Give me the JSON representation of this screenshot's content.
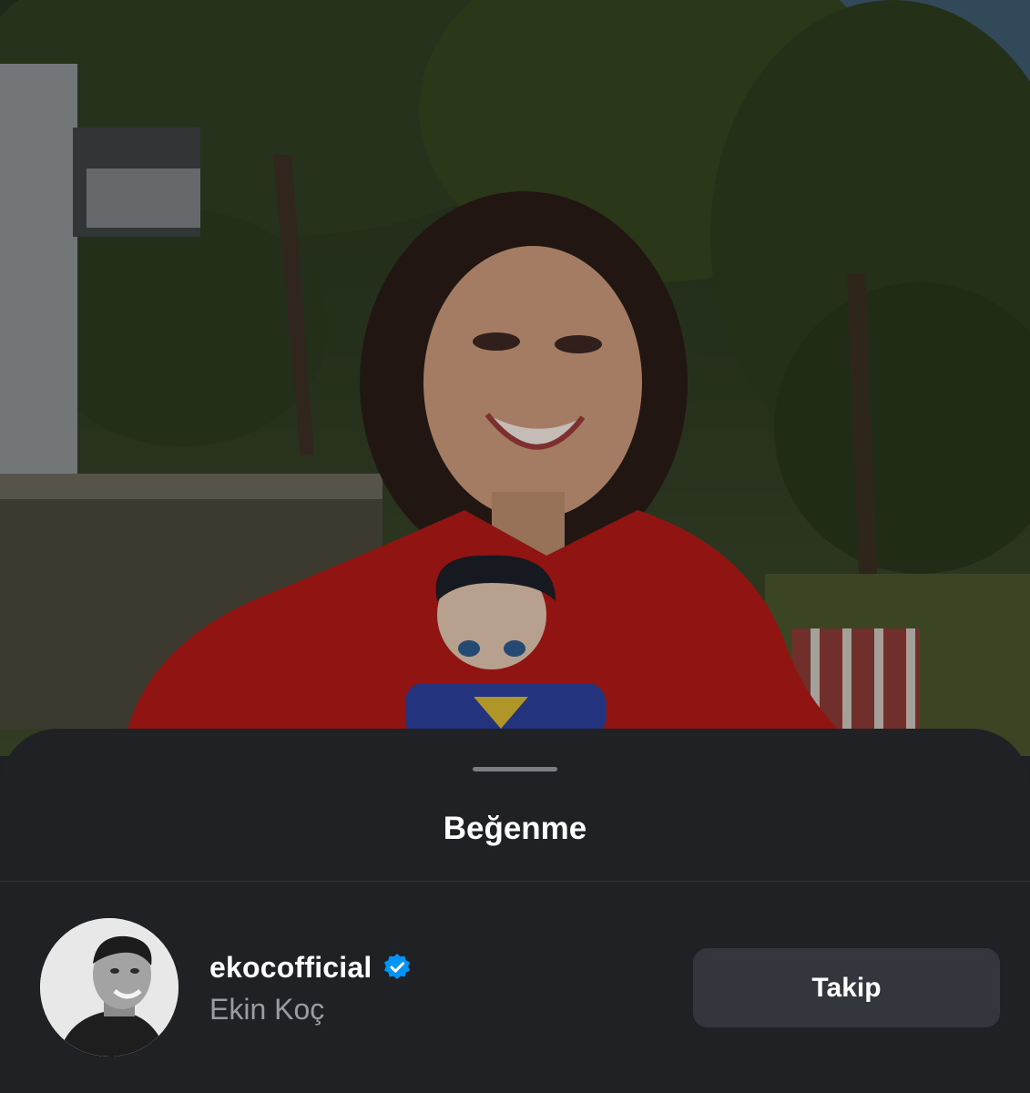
{
  "background_photo": {
    "description_icon": "photo-background"
  },
  "sheet": {
    "title": "Beğenme"
  },
  "likes": [
    {
      "username": "ekocofficial",
      "full_name": "Ekin Koç",
      "verified": true,
      "button_label": "Takip"
    }
  ],
  "colors": {
    "sheet_bg": "#202125",
    "button_bg": "#34363d",
    "verified_blue": "#0095f6",
    "secondary_text": "#9a9ca3"
  }
}
